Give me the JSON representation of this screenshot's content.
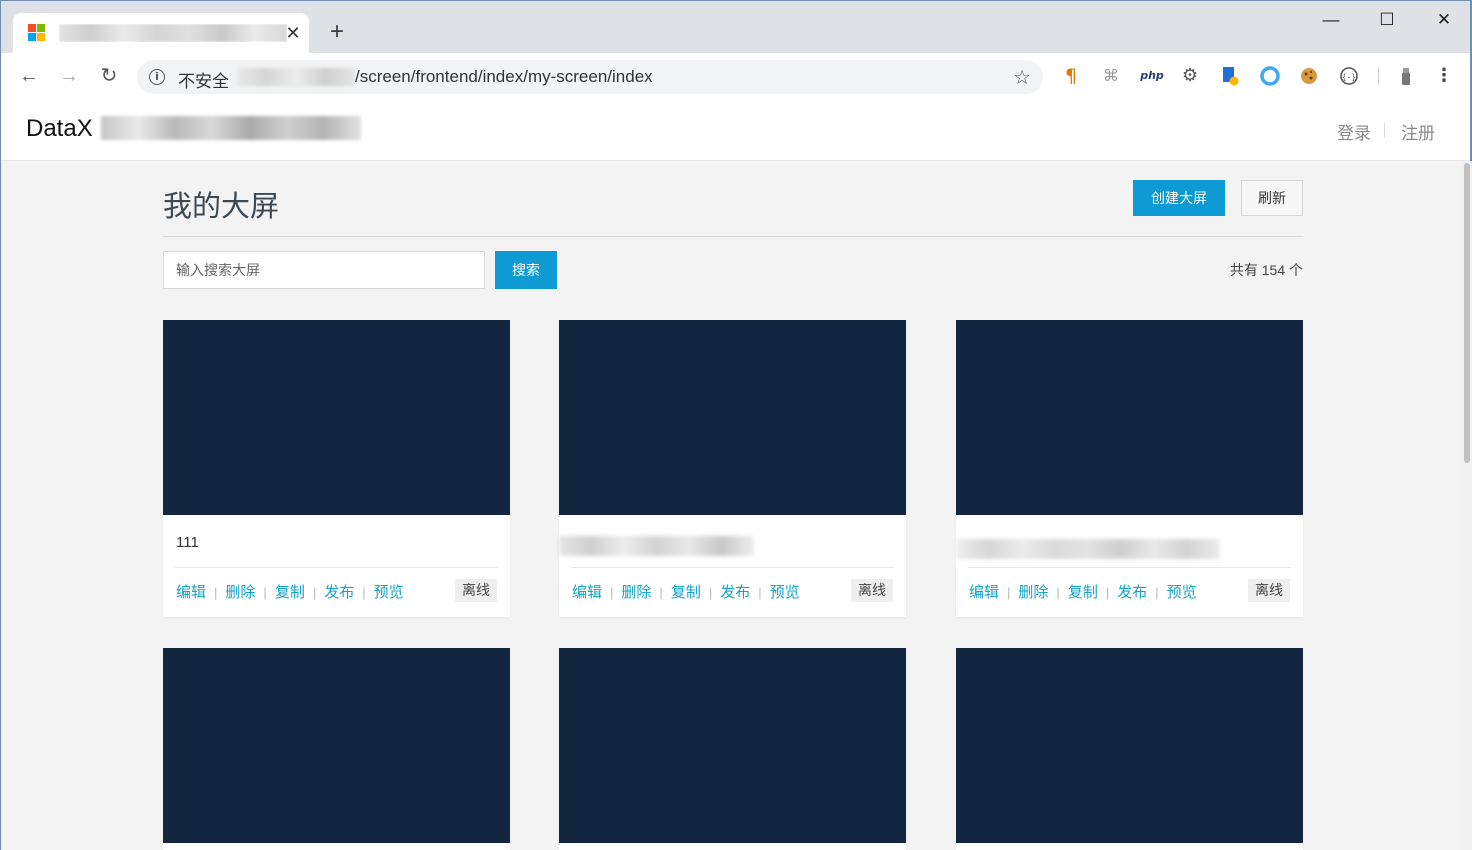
{
  "browser": {
    "tab_close": "✕",
    "new_tab": "+",
    "security_label": "不安全",
    "url_path": "/screen/frontend/index/my-screen/index",
    "extensions": [
      "paragraph-icon",
      "extension-icon",
      "php-icon",
      "gear-icon",
      "script-icon",
      "ring-icon",
      "cookie-icon",
      "code-icon",
      "spray-icon"
    ]
  },
  "header": {
    "logo": "DataX",
    "login": "登录",
    "register": "注册"
  },
  "main": {
    "title": "我的大屏",
    "create_button": "创建大屏",
    "refresh_button": "刷新",
    "search_placeholder": "输入搜索大屏",
    "search_button": "搜索",
    "total": "共有 154 个"
  },
  "card_actions": {
    "edit": "编辑",
    "delete": "删除",
    "copy": "复制",
    "publish": "发布",
    "preview": "预览",
    "sep": "|"
  },
  "cards": [
    {
      "name": "111",
      "status": "离线"
    },
    {
      "name": "",
      "status": "离线"
    },
    {
      "name": "",
      "status": "离线"
    },
    {
      "name": "",
      "status": ""
    },
    {
      "name": "",
      "status": ""
    },
    {
      "name": "",
      "status": ""
    }
  ],
  "colors": {
    "accent": "#0e9ad3",
    "link": "#15a3c9",
    "thumbnail": "#12263f"
  }
}
